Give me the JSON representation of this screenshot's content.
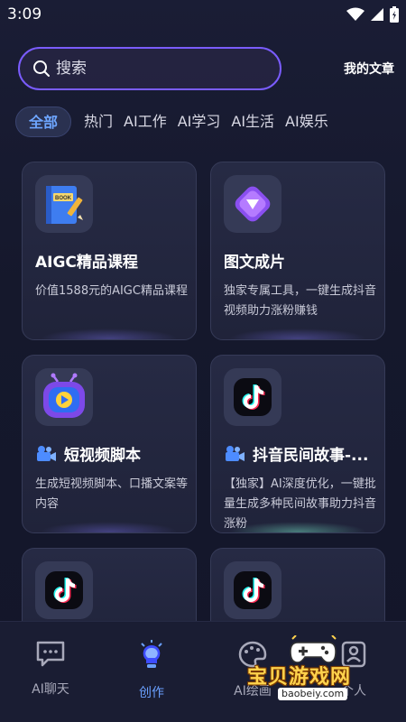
{
  "status_bar": {
    "time": "3:09"
  },
  "search": {
    "placeholder": "搜索"
  },
  "header": {
    "my_articles": "我的文章"
  },
  "tabs": [
    {
      "label": "全部",
      "active": true
    },
    {
      "label": "热门",
      "active": false
    },
    {
      "label": "AI工作",
      "active": false
    },
    {
      "label": "AI学习",
      "active": false
    },
    {
      "label": "AI生活",
      "active": false
    },
    {
      "label": "AI娱乐",
      "active": false
    }
  ],
  "cards": [
    {
      "title": "AIGC精品课程",
      "desc": "价值1588元的AIGC精品课程",
      "icon": "book-icon"
    },
    {
      "title": "图文成片",
      "desc": "独家专属工具，一键生成抖音视频助力涨粉赚钱",
      "icon": "play-icon"
    },
    {
      "title": "短视频脚本",
      "desc": "生成短视频脚本、口播文案等内容",
      "icon": "tv-icon"
    },
    {
      "title": "抖音民间故事-...",
      "desc": "【独家】AI深度优化，一键批量生成多种民间故事助力抖音涨粉",
      "icon": "tiktok-icon"
    },
    {
      "icon": "tiktok-icon"
    },
    {
      "icon": "tiktok-icon"
    }
  ],
  "bottom_nav": [
    {
      "label": "AI聊天",
      "icon": "chat-icon",
      "active": false
    },
    {
      "label": "创作",
      "icon": "bulb-icon",
      "active": true
    },
    {
      "label": "AI绘画",
      "icon": "palette-icon",
      "active": false
    },
    {
      "label": "个人",
      "icon": "person-icon",
      "active": false
    }
  ],
  "watermark": {
    "title": "宝贝游戏网",
    "url": "baobeiy.com"
  },
  "colors": {
    "accent": "#6aa0ff",
    "search_border": "#7a5cff",
    "background": "#15182c"
  }
}
